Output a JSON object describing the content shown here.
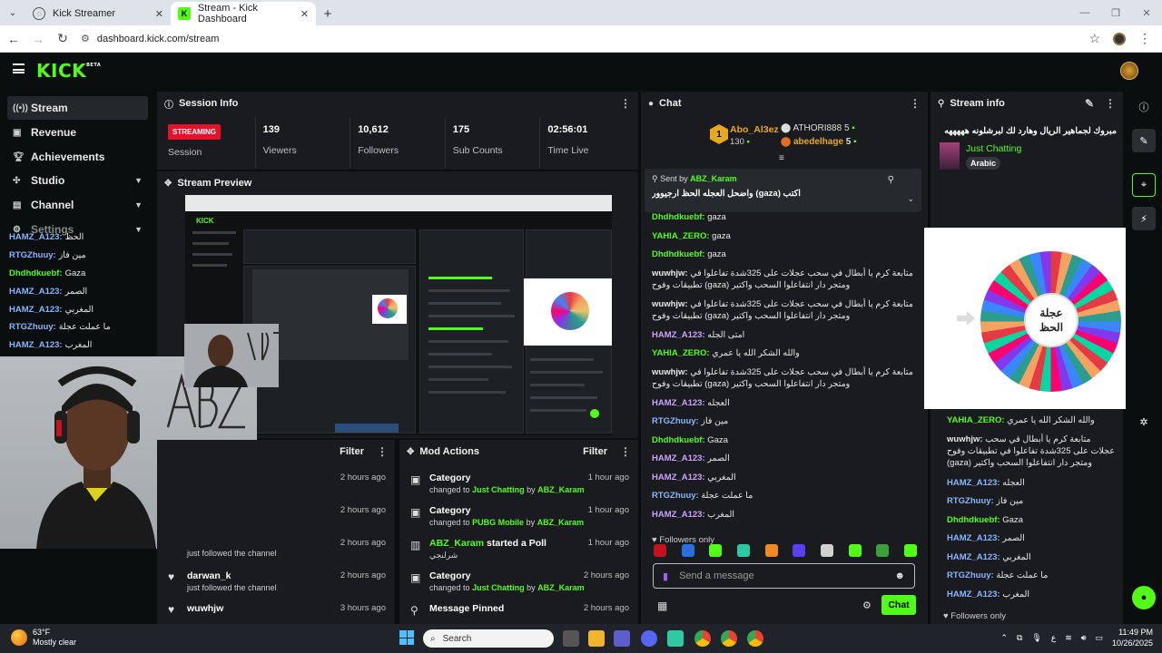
{
  "browser": {
    "tabs": [
      {
        "title": "Kick Streamer",
        "active": false
      },
      {
        "title": "Stream - Kick Dashboard",
        "active": true
      }
    ],
    "url": "dashboard.kick.com/stream"
  },
  "header": {
    "logo": "KICK",
    "logo_sup": "BETA"
  },
  "sidebar": {
    "items": [
      {
        "label": "Stream",
        "icon": "broadcast-icon"
      },
      {
        "label": "Revenue",
        "icon": "revenue-icon"
      },
      {
        "label": "Achievements",
        "icon": "trophy-icon"
      },
      {
        "label": "Studio",
        "icon": "studio-icon"
      },
      {
        "label": "Channel",
        "icon": "channel-icon"
      },
      {
        "label": "Settings",
        "icon": "gear-icon"
      }
    ]
  },
  "session": {
    "title": "Session Info",
    "status": "STREAMING",
    "status_label": "Session",
    "viewers": "139",
    "viewers_label": "Viewers",
    "followers": "10,612",
    "followers_label": "Followers",
    "subs": "175",
    "subs_label": "Sub Counts",
    "time": "02:56:01",
    "time_label": "Time Live"
  },
  "preview": {
    "title": "Stream Preview"
  },
  "overlay_chat": [
    {
      "user": "HAMZ_A123:",
      "msg": "الحظ",
      "color": "blue"
    },
    {
      "user": "RTGZhuuy:",
      "msg": "مين فاز",
      "color": "blue"
    },
    {
      "user": "Dhdhdkuebf:",
      "msg": "Gaza",
      "color": "green"
    },
    {
      "user": "HAMZ_A123:",
      "msg": "الصمر",
      "color": "blue"
    },
    {
      "user": "HAMZ_A123:",
      "msg": "المغربي",
      "color": "blue"
    },
    {
      "user": "RTGZhuuy:",
      "msg": "ما عملت عجلة",
      "color": "blue"
    },
    {
      "user": "HAMZ_A123:",
      "msg": "المغرب",
      "color": "blue"
    }
  ],
  "follows": {
    "filter": "Filter",
    "rows": [
      {
        "name": "",
        "sub": "",
        "time": "2 hours ago"
      },
      {
        "name": "",
        "sub": "",
        "time": "2 hours ago"
      },
      {
        "name": "",
        "sub": "just followed the channel",
        "time": "2 hours ago"
      },
      {
        "name": "darwan_k",
        "sub": "just followed the channel",
        "time": "2 hours ago"
      },
      {
        "name": "wuwhjw",
        "sub": "",
        "time": "3 hours ago"
      }
    ]
  },
  "mod_actions": {
    "title": "Mod Actions",
    "filter": "Filter",
    "rows": [
      {
        "title": "Category",
        "pre": "changed to",
        "target": "Just Chatting",
        "by": "by",
        "user": "ABZ_Karam",
        "time": "1 hour ago"
      },
      {
        "title": "Category",
        "pre": "changed to",
        "target": "PUBG Mobile",
        "by": "by",
        "user": "ABZ_Karam",
        "time": "1 hour ago"
      },
      {
        "title": "ABZ_Karam started a Poll",
        "pre": "شرلنجي",
        "target": "",
        "by": "",
        "user": "",
        "time": "1 hour ago"
      },
      {
        "title": "Category",
        "pre": "changed to",
        "target": "Just Chatting",
        "by": "by",
        "user": "ABZ_Karam",
        "time": "2 hours ago"
      },
      {
        "title": "Message Pinned",
        "pre": "",
        "target": "",
        "by": "",
        "user": "",
        "time": "2 hours ago"
      }
    ]
  },
  "chat": {
    "title": "Chat",
    "leaders": [
      {
        "rank": "1",
        "name": "Abo_Al3ez",
        "count": "130"
      },
      {
        "name": "ATHORI888",
        "count": "5"
      },
      {
        "name": "abedelhage",
        "count": "5"
      }
    ],
    "pinned": {
      "sent_by_label": "Sent by",
      "sender": "ABZ_Karam",
      "text": "واضحل العجله الحظ ارجيوور (gaza) اكتب"
    },
    "messages": [
      {
        "user": "Dhdhdkuebf:",
        "msg": "gaza",
        "color": "green"
      },
      {
        "user": "YAHIA_ZERO:",
        "msg": "gaza",
        "color": "green"
      },
      {
        "user": "Dhdhdkuebf:",
        "msg": "gaza",
        "color": "green"
      },
      {
        "user": "wuwhjw:",
        "msg": "متابعة كرم يا أبطال في سحب عجلات على 325شدة تفاعلوا في تطبيقات وفوح (gaza) ومتجر دار انتفاعلوا السحب واكتير",
        "color": "white"
      },
      {
        "user": "wuwhjw:",
        "msg": "متابعة كرم يا أبطال في سحب عجلات على 325شدة تفاعلوا في تطبيقات وفوح (gaza) ومتجر دار انتفاعلوا السحب واكتير",
        "color": "white"
      },
      {
        "user": "HAMZ_A123:",
        "msg": "امتى الجله",
        "color": "purple"
      },
      {
        "user": "YAHIA_ZERO:",
        "msg": "والله الشكر الله يا عمري",
        "color": "green"
      },
      {
        "user": "wuwhjw:",
        "msg": "متابعة كرم يا أبطال في سحب عجلات على 325شدة تفاعلوا في تطبيقات وفوح (gaza) ومتجر دار انتفاعلوا السحب واكتير",
        "color": "white"
      },
      {
        "user": "HAMZ_A123:",
        "msg": "العجله",
        "color": "purple"
      },
      {
        "user": "RTGZhuuy:",
        "msg": "مين فاز",
        "color": "blue"
      },
      {
        "user": "Dhdhdkuebf:",
        "msg": "Gaza",
        "color": "green"
      },
      {
        "user": "HAMZ_A123:",
        "msg": "الصمر",
        "color": "purple"
      },
      {
        "user": "HAMZ_A123:",
        "msg": "المغربي",
        "color": "purple"
      },
      {
        "user": "RTGZhuuy:",
        "msg": "ما عملت عجلة",
        "color": "blue"
      },
      {
        "user": "HAMZ_A123:",
        "msg": "المغرب",
        "color": "purple"
      }
    ],
    "followers_only": "Followers only",
    "input_placeholder": "Send a message",
    "send_label": "Chat"
  },
  "stream_info": {
    "title": "Stream info",
    "stream_title": "مبروك لجماهير الريال وهارد لك لبرشلونه هههههه",
    "category": "Just Chatting",
    "language": "Arabic",
    "wheel_label_1": "عجلة",
    "wheel_label_2": "الحظ",
    "right_chat": [
      {
        "user": "YAHIA_ZERO:",
        "msg": "والله الشكر الله يا عمري",
        "color": "green"
      },
      {
        "user": "wuwhjw:",
        "msg": "متابعة كرم يا أبطال في سحب عجلات على 325شدة تفاعلوا في تطبيقات وفوح (gaza) ومتجر دار انتفاعلوا السحب واكتير",
        "color": "white"
      },
      {
        "user": "HAMZ_A123:",
        "msg": "العجله",
        "color": "blue"
      },
      {
        "user": "RTGZhuuy:",
        "msg": "مين فاز",
        "color": "blue"
      },
      {
        "user": "Dhdhdkuebf:",
        "msg": "Gaza",
        "color": "green"
      },
      {
        "user": "HAMZ_A123:",
        "msg": "الصمر",
        "color": "blue"
      },
      {
        "user": "HAMZ_A123:",
        "msg": "المغربي",
        "color": "blue"
      },
      {
        "user": "RTGZhuuy:",
        "msg": "ما عملت عجلة",
        "color": "blue"
      },
      {
        "user": "HAMZ_A123:",
        "msg": "المغرب",
        "color": "blue"
      }
    ],
    "followers_only": "Followers only"
  },
  "taskbar": {
    "temp": "63°F",
    "weather": "Mostly clear",
    "search": "Search",
    "time": "11:49 PM",
    "date": "10/26/2025",
    "lang": "ع"
  },
  "colors": {
    "accent": "#53fc18",
    "live": "#e5112b",
    "bg": "#0b0e0f",
    "panel": "#191b1f"
  }
}
